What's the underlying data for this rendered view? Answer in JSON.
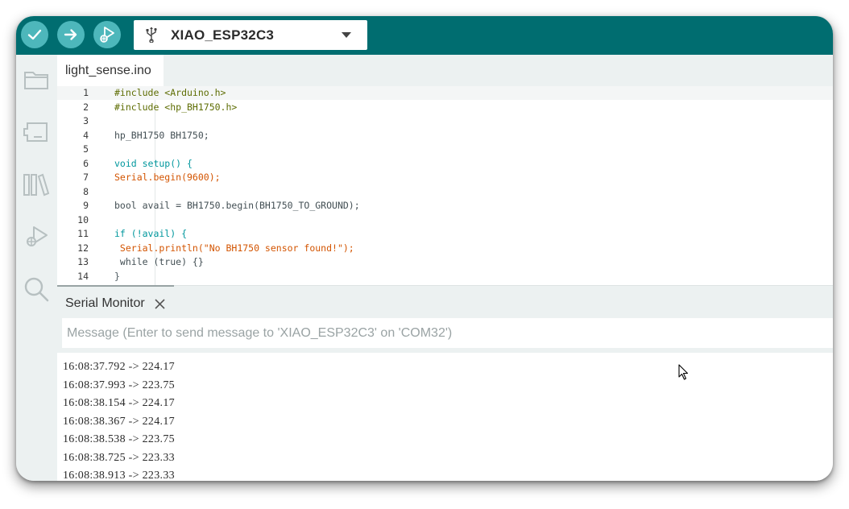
{
  "toolbar": {
    "verify_icon": "check-icon",
    "upload_icon": "arrow-right-icon",
    "debug_icon": "debug-icon",
    "board_icon": "usb-icon",
    "board_name": "XIAO_ESP32C3",
    "accent": "#006d70",
    "button_color": "#4db7bb"
  },
  "sidebar": {
    "items": [
      {
        "icon": "folder-icon"
      },
      {
        "icon": "board-manager-icon"
      },
      {
        "icon": "library-icon"
      },
      {
        "icon": "debug-icon"
      },
      {
        "icon": "search-icon"
      }
    ]
  },
  "editor": {
    "tab_label": "light_sense.ino",
    "lines": [
      {
        "n": "1",
        "text": "#include <Arduino.h>"
      },
      {
        "n": "2",
        "text": "#include <hp_BH1750.h>"
      },
      {
        "n": "3",
        "text": ""
      },
      {
        "n": "4",
        "text": "hp_BH1750 BH1750;"
      },
      {
        "n": "5",
        "text": ""
      },
      {
        "n": "6",
        "text": "void setup() {"
      },
      {
        "n": "7",
        "text": "Serial.begin(9600);"
      },
      {
        "n": "8",
        "text": ""
      },
      {
        "n": "9",
        "text": "bool avail = BH1750.begin(BH1750_TO_GROUND);"
      },
      {
        "n": "10",
        "text": ""
      },
      {
        "n": "11",
        "text": "if (!avail) {"
      },
      {
        "n": "12",
        "text": " Serial.println(\"No BH1750 sensor found!\");"
      },
      {
        "n": "13",
        "text": " while (true) {}"
      },
      {
        "n": "14",
        "text": "}"
      }
    ]
  },
  "serial_monitor": {
    "title": "Serial Monitor",
    "close_icon": "close-icon",
    "placeholder": "Message (Enter to send message to 'XIAO_ESP32C3' on 'COM32')",
    "output": [
      "16:08:37.792 -> 224.17",
      "16:08:37.993 -> 223.75",
      "16:08:38.154 -> 224.17",
      "16:08:38.367 -> 224.17",
      "16:08:38.538 -> 223.75",
      "16:08:38.725 -> 223.33",
      "16:08:38.913 -> 223.33"
    ]
  }
}
